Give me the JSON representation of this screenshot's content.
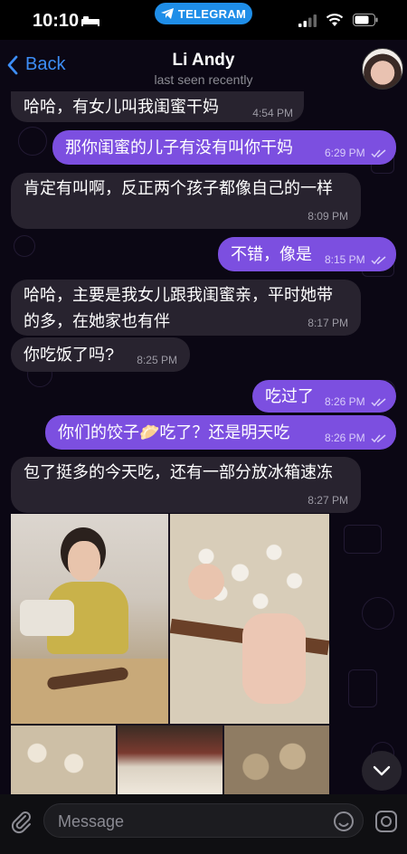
{
  "status_bar": {
    "time": "10:10",
    "pill": "TELEGRAM"
  },
  "header": {
    "back": "Back",
    "title": "Li Andy",
    "subtitle": "last seen recently"
  },
  "messages": [
    {
      "dir": "in",
      "text": "哈哈，有女儿叫我闺蜜干妈",
      "time": "4:54 PM"
    },
    {
      "dir": "out",
      "text": "那你闺蜜的儿子有没有叫你干妈",
      "time": "6:29 PM"
    },
    {
      "dir": "in",
      "text": "肯定有叫啊，反正两个孩子都像自己的一样",
      "time": "8:09 PM"
    },
    {
      "dir": "out",
      "text": "不错，像是",
      "time": "8:15 PM"
    },
    {
      "dir": "in",
      "text": "哈哈，主要是我女儿跟我闺蜜亲，平时她带的多，在她家也有伴",
      "time": "8:17 PM"
    },
    {
      "dir": "in",
      "text": "你吃饭了吗?",
      "time": "8:25 PM"
    },
    {
      "dir": "out",
      "text": "吃过了",
      "time": "8:26 PM"
    },
    {
      "dir": "out",
      "text": "你们的饺子🥟吃了？还是明天吃",
      "time": "8:26 PM"
    },
    {
      "dir": "in",
      "text": "包了挺多的今天吃，还有一部分放冰箱速冻",
      "time": "8:27 PM"
    }
  ],
  "input": {
    "placeholder": "Message"
  },
  "colors": {
    "accent": "#3d8ef7",
    "outgoing": "#7c4fe0",
    "incoming": "#28232f",
    "pill": "#1f8ee8"
  }
}
